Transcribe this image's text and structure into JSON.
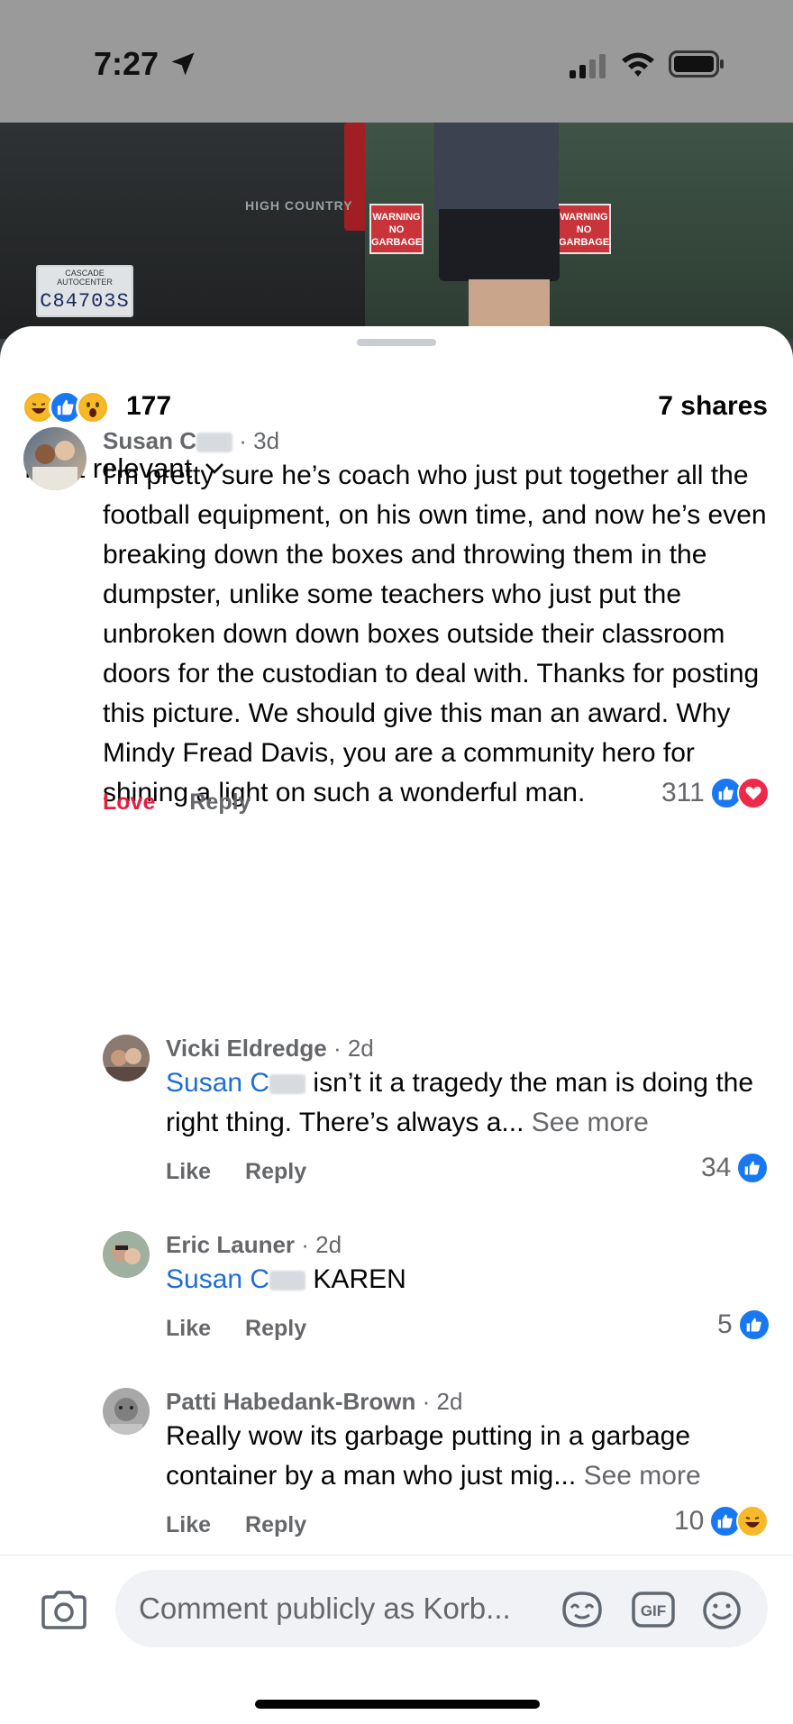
{
  "status": {
    "time": "7:27"
  },
  "photo": {
    "truck_badge": "HIGH COUNTRY",
    "plate_top": "CASCADE AUTOCENTER",
    "plate_number": "C84703S",
    "sign_text": "WARNING NO GARBAGE"
  },
  "reactions": {
    "icons": [
      "laugh-reaction-icon",
      "like-reaction-icon",
      "wow-reaction-icon"
    ],
    "count": "177",
    "shares": "7 shares"
  },
  "sort": {
    "label": "Most relevant"
  },
  "comments": [
    {
      "name": "Susan C",
      "time": "· 3d",
      "text": "I’m pretty sure he’s coach who just put together all the football equipment, on his own time, and now he’s even breaking down the boxes and throwing them in the dumpster, unlike some teachers who just put the unbroken down down boxes outside their classroom doors for the custodian to deal with. Thanks for posting this picture. We should give this man an award. Why Mindy Fread Davis, you are a community hero for shining a light on such a wonderful man.",
      "action1": "Love",
      "action2": "Reply",
      "reaction_count": "311"
    },
    {
      "name": "Vicki Eldredge",
      "time": "· 2d",
      "mention": "Susan C",
      "text": "isn’t it a tragedy the man is doing the right thing. There’s always a...",
      "see_more": "See more",
      "action1": "Like",
      "action2": "Reply",
      "reaction_count": "34"
    },
    {
      "name": "Eric Launer",
      "time": "· 2d",
      "mention": "Susan C",
      "text": "KAREN",
      "action1": "Like",
      "action2": "Reply",
      "reaction_count": "5"
    },
    {
      "name": "Patti Habedank-Brown",
      "time": "· 2d",
      "text": "Really wow its garbage putting in a garbage container by a man who just mig...",
      "see_more": "See more",
      "action1": "Like",
      "action2": "Reply",
      "reaction_count": "10"
    }
  ],
  "composer": {
    "placeholder": "Comment publicly as Korb..."
  },
  "colors": {
    "accent": "#1877f2",
    "love": "#e41e3f",
    "mention": "#1f6ed4",
    "muted": "#65676b"
  }
}
